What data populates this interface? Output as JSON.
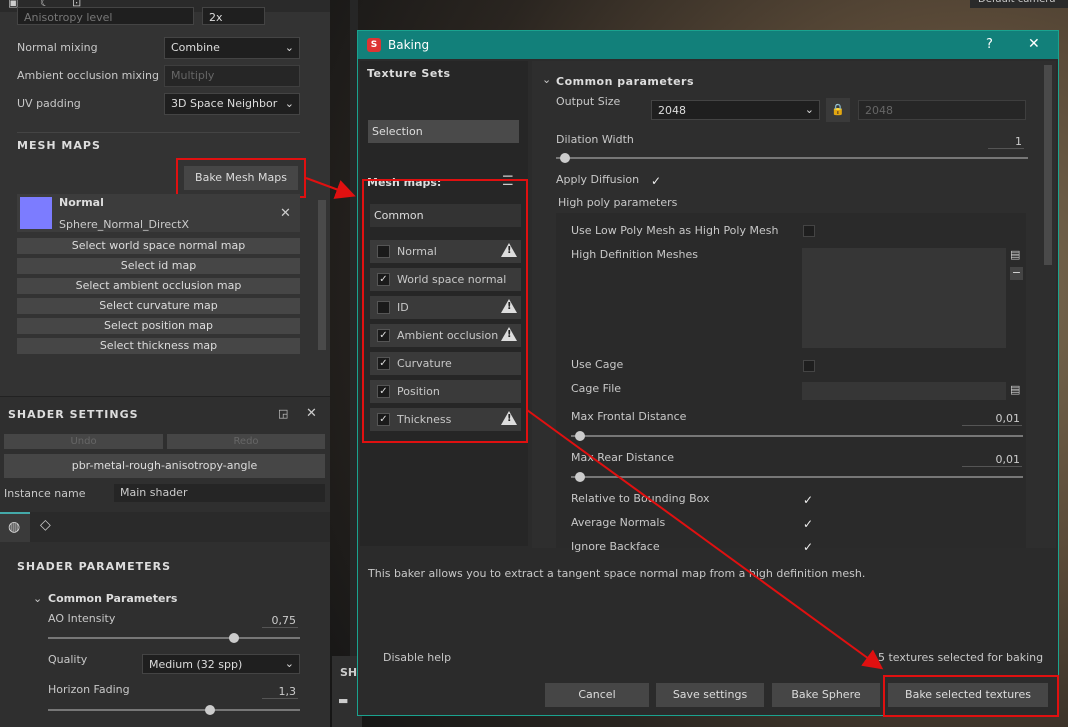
{
  "left_panel": {
    "anisotropy_label": "Anisotropy level",
    "anisotropy_value": "2x",
    "normal_mixing_label": "Normal mixing",
    "normal_mixing_value": "Combine",
    "ao_mixing_label": "Ambient occlusion mixing",
    "ao_mixing_value": "Multiply",
    "uv_padding_label": "UV padding",
    "uv_padding_value": "3D Space Neighbor",
    "mesh_maps_header": "MESH MAPS",
    "bake_button": "Bake Mesh Maps",
    "normal_map_title": "Normal",
    "normal_map_file": "Sphere_Normal_DirectX",
    "select_maps": [
      "Select world space normal map",
      "Select id map",
      "Select ambient occlusion map",
      "Select curvature map",
      "Select position map",
      "Select thickness map"
    ]
  },
  "shader_settings": {
    "header": "SHADER SETTINGS",
    "undo": "Undo",
    "redo": "Redo",
    "shader_name": "pbr-metal-rough-anisotropy-angle",
    "instance_label": "Instance name",
    "instance_value": "Main shader",
    "params_header": "SHADER PARAMETERS",
    "common_header": "Common Parameters",
    "ao_intensity_label": "AO Intensity",
    "ao_intensity_value": "0,75",
    "quality_label": "Quality",
    "quality_value": "Medium (32 spp)",
    "horizon_label": "Horizon Fading",
    "horizon_value": "1,3"
  },
  "viewport": {
    "camera_label": "Default camera",
    "bottom_tab": "SH"
  },
  "dialog": {
    "title": "Baking",
    "help": "?",
    "close": "✕",
    "texture_sets_header": "Texture Sets",
    "selection": "Selection",
    "mesh_maps_header": "Mesh maps:",
    "common": "Common",
    "mesh_maps": [
      {
        "label": "Normal",
        "checked": false,
        "warn": true
      },
      {
        "label": "World space normal",
        "checked": true,
        "warn": false
      },
      {
        "label": "ID",
        "checked": false,
        "warn": true
      },
      {
        "label": "Ambient occlusion",
        "checked": true,
        "warn": true
      },
      {
        "label": "Curvature",
        "checked": true,
        "warn": false
      },
      {
        "label": "Position",
        "checked": true,
        "warn": false
      },
      {
        "label": "Thickness",
        "checked": true,
        "warn": true
      }
    ],
    "common_params_header": "Common parameters",
    "output_size_label": "Output Size",
    "output_size_value": "2048",
    "output_size_linked": "2048",
    "dilation_label": "Dilation Width",
    "dilation_value": "1",
    "apply_diffusion_label": "Apply Diffusion",
    "high_poly_header": "High poly parameters",
    "use_low_poly_label": "Use Low Poly Mesh as High Poly Mesh",
    "hd_meshes_label": "High Definition Meshes",
    "use_cage_label": "Use Cage",
    "cage_file_label": "Cage File",
    "max_frontal_label": "Max Frontal Distance",
    "max_frontal_value": "0,01",
    "max_rear_label": "Max Rear Distance",
    "max_rear_value": "0,01",
    "relative_bbox_label": "Relative to Bounding Box",
    "average_normals_label": "Average Normals",
    "ignore_backface_label": "Ignore Backface",
    "help_text": "This baker allows you to extract a tangent space normal map from a high definition mesh.",
    "disable_help": "Disable help",
    "selected_count": "5 textures selected for baking",
    "cancel": "Cancel",
    "save_settings": "Save settings",
    "bake_sphere": "Bake Sphere",
    "bake_selected": "Bake selected textures"
  },
  "colors": {
    "accent_teal": "#12807a",
    "highlight_red": "#e01010"
  }
}
